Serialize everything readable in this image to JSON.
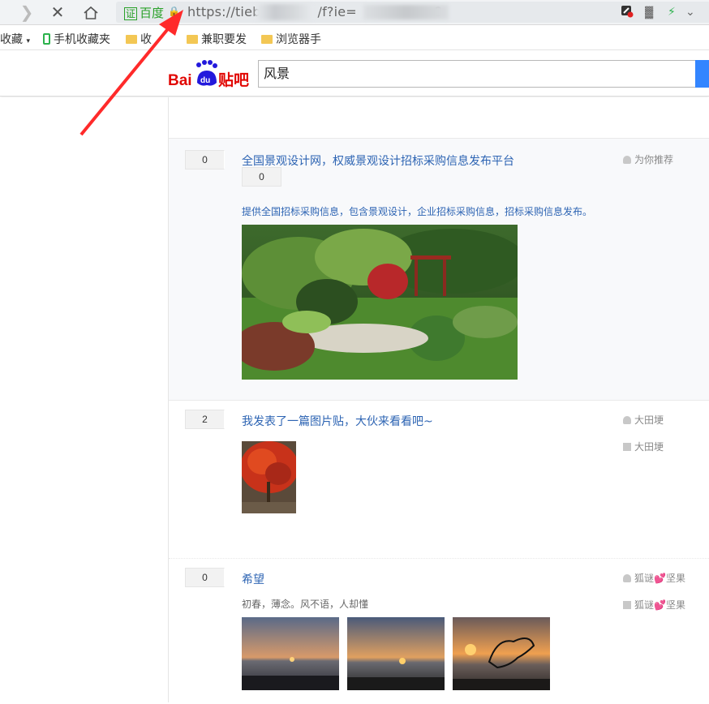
{
  "browser": {
    "cert_box": "证",
    "cert_label": "百度",
    "url_prefix": "https://tieb",
    "url_mid": "/f?ie=",
    "url_tail": "8"
  },
  "bookmarks": [
    {
      "label": "收藏",
      "folder": false
    },
    {
      "label": "手机收藏夹",
      "folder": false
    },
    {
      "label": "收",
      "folder": true
    },
    {
      "label": "兼职要发",
      "folder": true
    },
    {
      "label": "浏览器手",
      "folder": true
    }
  ],
  "header": {
    "logo_bai": "Bai",
    "logo_du": "du",
    "logo_tieba": "贴吧",
    "search_value": "风景"
  },
  "posts": [
    {
      "count": "0",
      "count2": "0",
      "title": "全国景观设计网，权威景观设计招标采购信息发布平台",
      "desc": "提供全国招标采购信息，包含景观设计，企业招标采购信息，招标采购信息发布。",
      "author": "为你推荐"
    },
    {
      "count": "2",
      "title": "我发表了一篇图片贴，大伙来看看吧~",
      "author": "大田埂",
      "last_reply": "大田埂"
    },
    {
      "count": "0",
      "title": "希望",
      "desc": "初春，薄念。风不语，人却懂",
      "author": "狐谜💕坚果",
      "last_reply": "狐谜💕坚果"
    }
  ],
  "colors": {
    "link": "#2d64b3",
    "search_button": "#3385ff",
    "annotation_arrow": "#ff2a2a"
  }
}
